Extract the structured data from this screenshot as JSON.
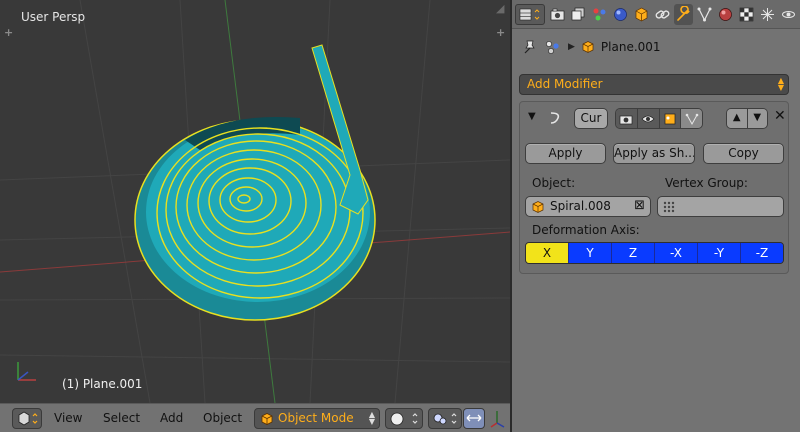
{
  "viewport": {
    "view_label": "User Persp",
    "object_label": "(1) Plane.001",
    "menus": [
      "View",
      "Select",
      "Add",
      "Object"
    ],
    "mode": "Object Mode"
  },
  "properties": {
    "breadcrumb_object": "Plane.001",
    "add_modifier_label": "Add Modifier",
    "modifier": {
      "name": "Cur",
      "apply_label": "Apply",
      "apply_as_shape_label": "Apply as Sh...",
      "copy_label": "Copy",
      "object_label": "Object:",
      "object_value": "Spiral.008",
      "vertex_group_label": "Vertex Group:",
      "vertex_group_value": "",
      "deformation_axis_label": "Deformation Axis:",
      "axes": [
        "X",
        "Y",
        "Z",
        "-X",
        "-Y",
        "-Z"
      ],
      "selected_axis": "X"
    },
    "tabs": [
      "render-tab",
      "render-layers-tab",
      "scene-tab",
      "world-tab",
      "object-tab",
      "constraints-tab",
      "modifiers-tab",
      "data-tab",
      "material-tab",
      "texture-tab",
      "particles-tab"
    ],
    "active_tab": "modifiers-tab"
  },
  "colors": {
    "accent_orange": "#ffae1a",
    "mesh_cyan": "#1fa9b8",
    "selection_yellow": "#f2e31a",
    "axis_blue": "#0a3bff"
  }
}
